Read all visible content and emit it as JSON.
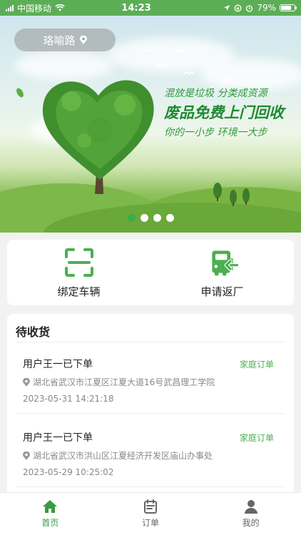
{
  "status_bar": {
    "carrier": "中国移动",
    "time": "14:23",
    "battery": "79%",
    "battery_level": 0.79
  },
  "banner": {
    "location": "珞喻路",
    "slogan_line1": "混放是垃圾 分类成资源",
    "slogan_line2": "废品免费上门回收",
    "slogan_line3": "你的一小步 环境一大步",
    "slide_count": 4,
    "active_slide": 0
  },
  "actions": {
    "bind_vehicle": "绑定车辆",
    "return_factory": "申请返厂"
  },
  "pending": {
    "title": "待收货",
    "orders": [
      {
        "user": "用户王一已下单",
        "type": "家庭订单",
        "address": "湖北省武汉市江夏区江夏大道16号武昌理工学院",
        "time": "2023-05-31 14:21:18"
      },
      {
        "user": "用户王一已下单",
        "type": "家庭订单",
        "address": "湖北省武汉市洪山区江夏经济开发区庙山办事处",
        "time": "2023-05-29 10:25:02"
      }
    ]
  },
  "tabs": {
    "home": "首页",
    "orders": "订单",
    "mine": "我的"
  },
  "colors": {
    "primary": "#4caf50",
    "status_bar": "#5cae56",
    "active_tab": "#3a9b43"
  }
}
